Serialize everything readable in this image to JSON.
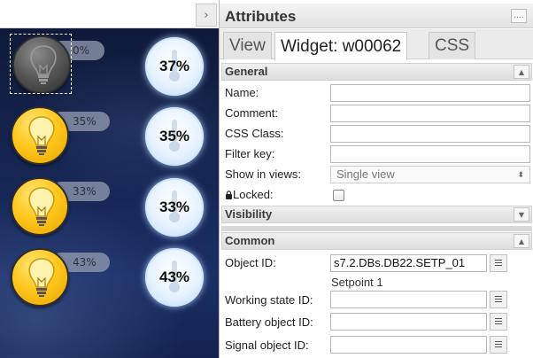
{
  "canvas": {
    "collapse_icon": "chevron-right-icon",
    "collapse_glyph": "›",
    "rows": [
      {
        "bulb_state": "off",
        "percent_label": "0%",
        "gauge_value": "37%"
      },
      {
        "bulb_state": "on",
        "percent_label": "35%",
        "gauge_value": "35%"
      },
      {
        "bulb_state": "on",
        "percent_label": "33%",
        "gauge_value": "33%"
      },
      {
        "bulb_state": "on",
        "percent_label": "43%",
        "gauge_value": "43%"
      }
    ],
    "colors": {
      "bulb_on": "#fec81e",
      "bulb_off": "#555555",
      "background": "#162654",
      "gauge": "#d6eaff"
    }
  },
  "panel": {
    "title": "Attributes",
    "menu_glyph": "....",
    "tabs": [
      {
        "label": "View",
        "active": false
      },
      {
        "label": "Widget: w00062",
        "active": true
      },
      {
        "label": "CSS",
        "active": false
      }
    ],
    "sections": {
      "general": {
        "title": "General",
        "toggle": "▲"
      },
      "visibility": {
        "title": "Visibility",
        "toggle": "▼"
      },
      "common": {
        "title": "Common",
        "toggle": "▲"
      }
    },
    "general_fields": {
      "name": {
        "label": "Name:",
        "value": ""
      },
      "comment": {
        "label": "Comment:",
        "value": ""
      },
      "css_class": {
        "label": "CSS Class:",
        "value": ""
      },
      "filter_key": {
        "label": "Filter key:",
        "value": ""
      },
      "show_in_views": {
        "label": "Show in views:",
        "value": "Single view",
        "arrow": "⬍"
      },
      "locked": {
        "label": "Locked:",
        "icon": "lock-icon",
        "checked": false
      }
    },
    "common_fields": {
      "object_id": {
        "label": "Object ID:",
        "value": "s7.2.DBs.DB22.SETP_01",
        "hint": "Setpoint 1"
      },
      "working_state_id": {
        "label": "Working state ID:",
        "value": ""
      },
      "battery_object_id": {
        "label": "Battery object ID:",
        "value": ""
      },
      "signal_object_id": {
        "label": "Signal object ID:",
        "value": ""
      }
    }
  }
}
